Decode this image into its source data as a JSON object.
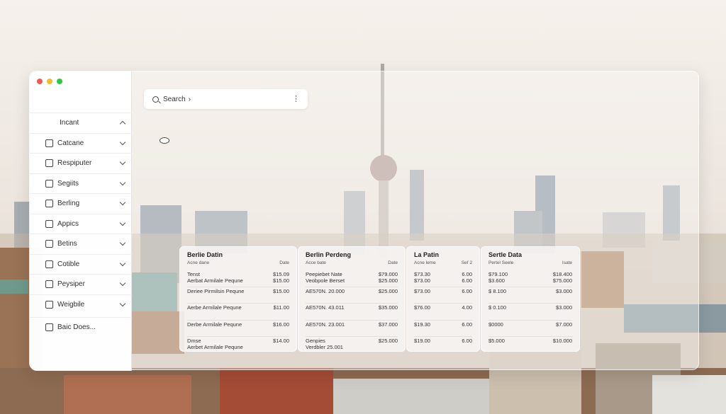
{
  "window": {
    "controls": [
      "close",
      "minimize",
      "maximize"
    ]
  },
  "search": {
    "label": "Search",
    "caret": "›",
    "more": "⋮"
  },
  "sidebar": {
    "items": [
      {
        "label": "Incant",
        "icon": "search-icon",
        "expanded": true
      },
      {
        "label": "Catcane",
        "icon": "square-icon"
      },
      {
        "label": "Respiputer",
        "icon": "folder-icon"
      },
      {
        "label": "Segiits",
        "icon": "document-icon"
      },
      {
        "label": "Berling",
        "icon": "calendar-icon"
      },
      {
        "label": "Appics",
        "icon": "edit-icon"
      },
      {
        "label": "Betins",
        "icon": "list-icon"
      },
      {
        "label": "Cotible",
        "icon": "tools-icon"
      },
      {
        "label": "Peysiper",
        "icon": "chart-icon"
      },
      {
        "label": "Weigbile",
        "icon": "file-icon"
      },
      {
        "label": "Baic Does...",
        "icon": "checkbox-icon"
      }
    ]
  },
  "panels": [
    {
      "title": "Berlie Datin",
      "sub": [
        "Acne dane",
        "Date"
      ],
      "rows": [
        {
          "label": "Tenst\nAerbat Armilale Pequne",
          "values": [
            "$15.09",
            "$15.00"
          ]
        },
        {
          "label": "Deriee Pirmilsin Pequne",
          "values": [
            "$15.00"
          ]
        },
        {
          "label": "Aerbe Armilale Pequne",
          "values": [
            "$11.00"
          ]
        },
        {
          "label": "Derbe Armilale Pequne",
          "values": [
            "$16.00"
          ]
        },
        {
          "label": "Dmse\nAerbet Armilale Pequne",
          "values": [
            "$14.00"
          ]
        }
      ]
    },
    {
      "title": "Berlin Perdeng",
      "sub": [
        "Acce bate",
        "Date"
      ],
      "rows": [
        {
          "label": "Peepiebet Nate\nVeobpole Berset",
          "values": [
            "$79.000",
            "$25.000"
          ]
        },
        {
          "label": "AE570N. 20.000",
          "values": [
            "$25.000"
          ]
        },
        {
          "label": "AE570N. 43.011",
          "values": [
            "$35.000"
          ]
        },
        {
          "label": "AE570N. 23.001",
          "values": [
            "$37.000"
          ]
        },
        {
          "label": "Genpies\nVerdbler 25.001",
          "values": [
            "$25.000"
          ]
        }
      ]
    },
    {
      "title": "La Patin",
      "sub": [
        "Acne leme",
        "Sef 2"
      ],
      "rows": [
        {
          "label": "$73.30\n$73.00",
          "values": [
            "6.00",
            "6.00"
          ]
        },
        {
          "label": "$73.00",
          "values": [
            "6.00"
          ]
        },
        {
          "label": "$76.00",
          "values": [
            "4.00"
          ]
        },
        {
          "label": "$19.30",
          "values": [
            "6.00"
          ]
        },
        {
          "label": "$19.00",
          "values": [
            "6.00"
          ]
        }
      ]
    },
    {
      "title": "Sertle Data",
      "sub": [
        "Pertel Seele",
        "Isate"
      ],
      "rows": [
        {
          "label": "$79.100\n$3.600",
          "values": [
            "$18.400",
            "$75.000"
          ]
        },
        {
          "label": "$ 8.100",
          "values": [
            "$3.000"
          ]
        },
        {
          "label": "$ 0.100",
          "values": [
            "$3.000"
          ]
        },
        {
          "label": "$0000",
          "values": [
            "$7.000"
          ]
        },
        {
          "label": "$5.000",
          "values": [
            "$10.000"
          ]
        }
      ]
    }
  ]
}
